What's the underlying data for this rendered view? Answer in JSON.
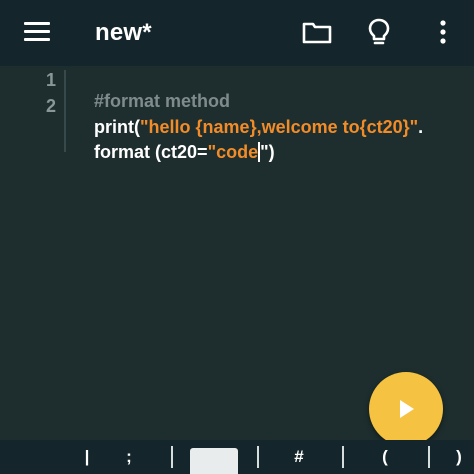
{
  "app": {
    "title": "new*"
  },
  "toolbar": {
    "menu_icon": "hamburger-menu-icon",
    "folder_icon": "folder-icon",
    "hint_icon": "lightbulb-icon",
    "more_icon": "more-vertical-icon"
  },
  "editor": {
    "line_numbers": [
      "1",
      "2"
    ],
    "line1": {
      "comment": "#format method"
    },
    "line2": {
      "code_start": "print(",
      "string": "\"hello {name},welcome to{ct20}\"",
      "code_end": "."
    },
    "line2_wrap": {
      "code_start": "format (ct20=",
      "string": "\"code",
      "code_end": "\")"
    }
  },
  "run_button": {
    "icon": "play-icon",
    "color": "#f5c242"
  },
  "keybar": {
    "keys": [
      "|",
      ";",
      "",
      "#",
      "(",
      ")"
    ]
  },
  "colors": {
    "background": "#1e2e2e",
    "toolbar": "#14262b",
    "string": "#f28c28",
    "comment": "#7f8b8c"
  }
}
